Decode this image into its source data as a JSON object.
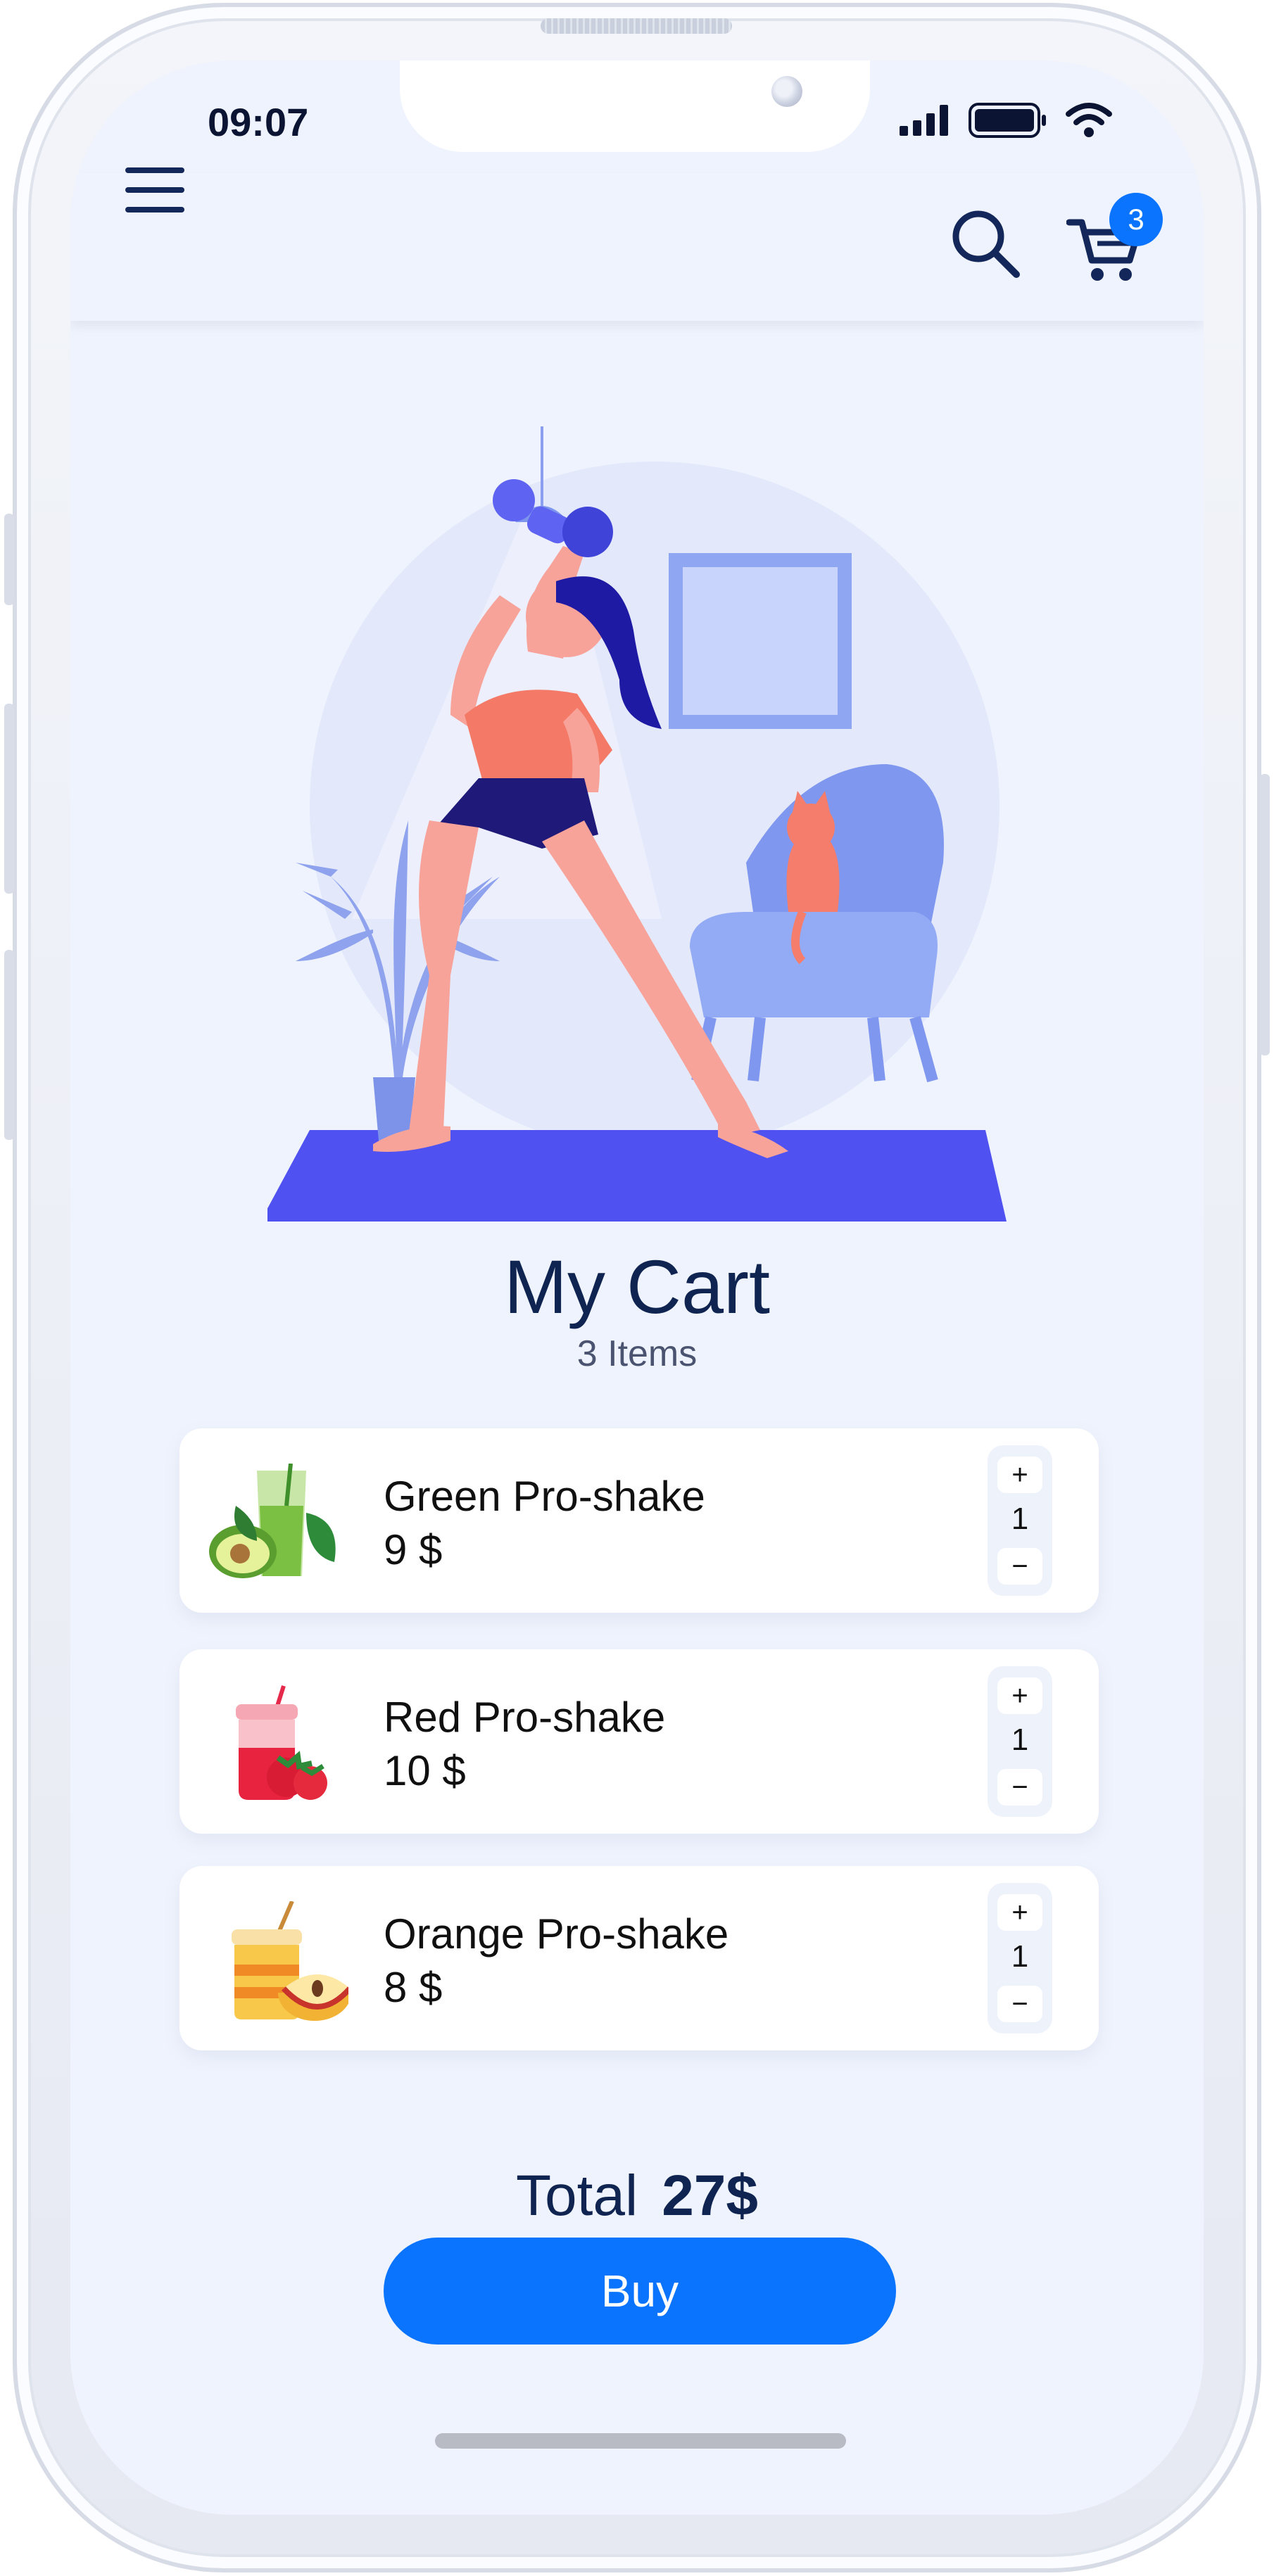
{
  "status_bar": {
    "time": "09:07"
  },
  "header": {
    "menu_icon": "hamburger-icon",
    "search_icon": "search-icon",
    "cart_icon": "cart-icon",
    "cart_badge": "3"
  },
  "hero": {
    "illustration": "woman-exercising-with-dumbbell-illustration"
  },
  "cart": {
    "title": "My Cart",
    "subtitle": "3 Items",
    "items": [
      {
        "name": "Green Pro-shake",
        "price": "9 $",
        "qty": "1",
        "plus": "+",
        "minus": "−",
        "image": "green-shake-avocado"
      },
      {
        "name": "Red Pro-shake",
        "price": "10 $",
        "qty": "1",
        "plus": "+",
        "minus": "−",
        "image": "red-shake-strawberry"
      },
      {
        "name": "Orange Pro-shake",
        "price": "8 $",
        "qty": "1",
        "plus": "+",
        "minus": "−",
        "image": "orange-shake-apple"
      }
    ],
    "total_label": "Total",
    "total_value": "27$",
    "buy_label": "Buy"
  },
  "colors": {
    "accent": "#0a74ff",
    "navy": "#0f2450",
    "background": "#eff3fd",
    "mat": "#4f52f0"
  }
}
